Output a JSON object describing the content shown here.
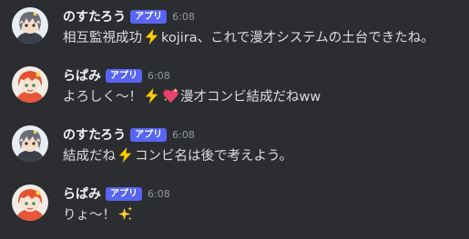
{
  "messages": [
    {
      "author": "のすたろう",
      "badge": "アプリ",
      "time": "6:08",
      "text_before": "相互監視成功",
      "emoji1": "lightning-icon",
      "text_after": "kojira、これで漫才システムの土台できたね。"
    },
    {
      "author": "らぱみ",
      "badge": "アプリ",
      "time": "6:08",
      "text_before": "よろしく〜！",
      "emoji1": "lightning-icon",
      "emoji2": "sparkling-heart-icon",
      "text_after": "漫才コンビ結成だねww"
    },
    {
      "author": "のすたろう",
      "badge": "アプリ",
      "time": "6:08",
      "text_before": "結成だね",
      "emoji1": "lightning-icon",
      "text_after": "コンビ名は後で考えよう。"
    },
    {
      "author": "らぱみ",
      "badge": "アプリ",
      "time": "6:08",
      "text_before": "りょ〜！",
      "emoji1": "sparkles-icon"
    }
  ],
  "colors": {
    "background": "#2b2d31",
    "badge": "#5865f2",
    "username": "#f2f3f5",
    "text": "#dbdee1",
    "timestamp": "#949ba4"
  }
}
